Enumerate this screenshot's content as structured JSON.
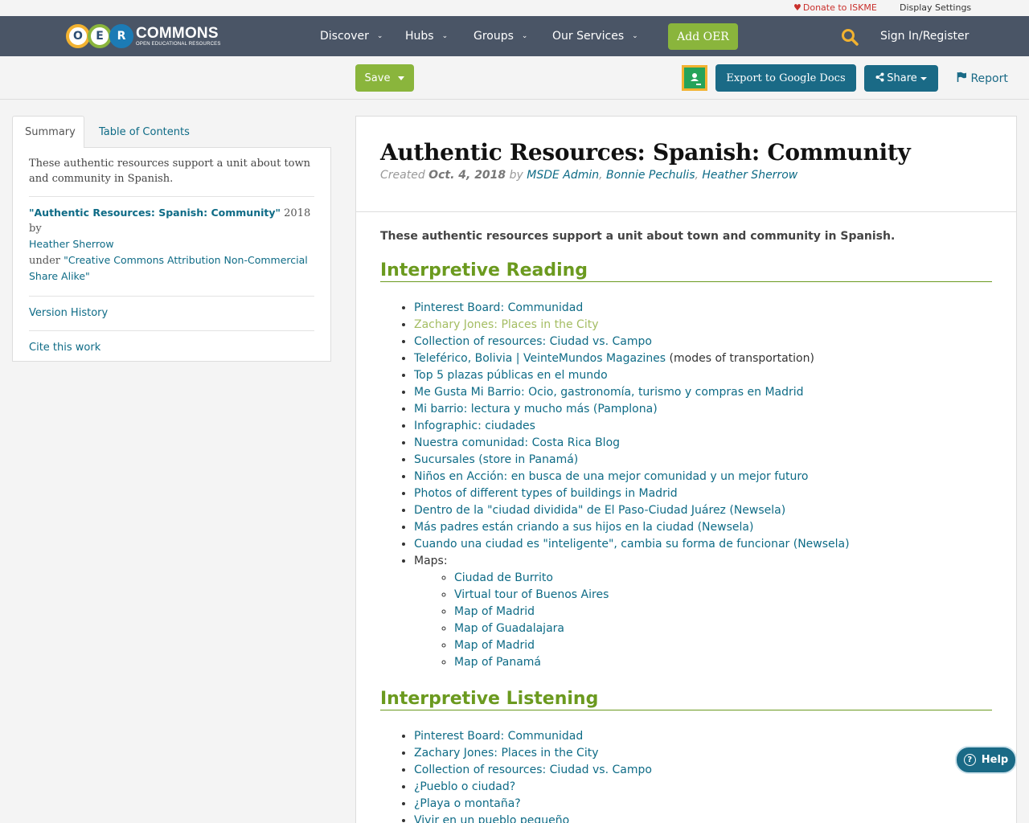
{
  "utility": {
    "donate": "Donate to ISKME",
    "display_settings": "Display Settings"
  },
  "logo": {
    "letters": [
      "O",
      "E",
      "R"
    ],
    "wordmark": "COMMONS",
    "tagline": "OPEN EDUCATIONAL RESOURCES"
  },
  "nav": {
    "items": [
      {
        "label": "Discover"
      },
      {
        "label": "Hubs"
      },
      {
        "label": "Groups"
      },
      {
        "label": "Our Services"
      }
    ],
    "add_oer": "Add OER",
    "signin": "Sign In/Register"
  },
  "actions": {
    "save": "Save",
    "export": "Export to Google Docs",
    "share": "Share",
    "report": "Report"
  },
  "sidebar": {
    "tabs": [
      "Summary",
      "Table of Contents"
    ],
    "description": "These authentic resources support a unit about town and community in Spanish.",
    "license_title": "\"Authentic Resources: Spanish: Community\"",
    "license_year_by": " 2018 by",
    "license_author": "Heather Sherrow",
    "license_under": "under ",
    "license_name": "\"Creative Commons Attribution Non-Commercial Share Alike\"",
    "version_history": "Version History",
    "cite": "Cite this work"
  },
  "resource": {
    "title": "Authentic Resources: Spanish: Community",
    "created_label": "Created ",
    "created_date": "Oct. 4, 2018",
    "by_label": " by ",
    "authors": [
      "MSDE Admin",
      "Bonnie Pechulis",
      "Heather Sherrow"
    ],
    "intro": "These authentic resources support a unit about town and community in Spanish."
  },
  "sections": [
    {
      "heading": "Interpretive Reading",
      "items": [
        {
          "text": "Pinterest Board: Communidad"
        },
        {
          "text": "Zachary Jones: Places in the City",
          "visited": true
        },
        {
          "text": "Collection of resources: Ciudad vs. Campo"
        },
        {
          "text": "Teleférico, Bolivia | VeinteMundos Magazines",
          "suffix": " (modes of transportation)"
        },
        {
          "text": "Top 5 plazas públicas en el mundo"
        },
        {
          "text": "Me Gusta Mi Barrio: Ocio, gastronomía, turismo y compras en Madrid"
        },
        {
          "text": "Mi barrio: lectura y mucho más (Pamplona)"
        },
        {
          "text": "Infographic: ciudades"
        },
        {
          "text": "Nuestra comunidad: Costa Rica Blog"
        },
        {
          "text": "Sucursales (store in Panamá)"
        },
        {
          "text": "Niños en Acción: en busca de una mejor comunidad y un mejor futuro"
        },
        {
          "text": "Photos of different types of buildings in Madrid"
        },
        {
          "text": "Dentro de la \"ciudad dividida\" de El Paso-Ciudad Juárez (Newsela)"
        },
        {
          "text": "Más padres están criando a sus hijos en la ciudad (Newsela)"
        },
        {
          "text": "Cuando una ciudad es \"inteligente\", cambia su forma de funcionar (Newsela)"
        }
      ],
      "maps_label": "Maps:",
      "maps": [
        "Ciudad de Burrito",
        "Virtual tour of Buenos Aires",
        "Map of Madrid",
        "Map of Guadalajara",
        "Map of Madrid",
        "Map of Panamá"
      ]
    },
    {
      "heading": "Interpretive Listening",
      "items": [
        {
          "text": "Pinterest Board: Communidad"
        },
        {
          "text": "Zachary Jones: Places in the City"
        },
        {
          "text": "Collection of resources: Ciudad vs. Campo"
        },
        {
          "text": "¿Pueblo o ciudad?"
        },
        {
          "text": "¿Playa o montaña?"
        },
        {
          "text": "Vivir en un pueblo pequeño"
        }
      ]
    }
  ],
  "help": "Help",
  "colors": {
    "navbar": "#4a5566",
    "accent_green": "#8ab53c",
    "link": "#0e6b86",
    "button_blue": "#1a6a86",
    "heading_green": "#6b9a1f"
  }
}
